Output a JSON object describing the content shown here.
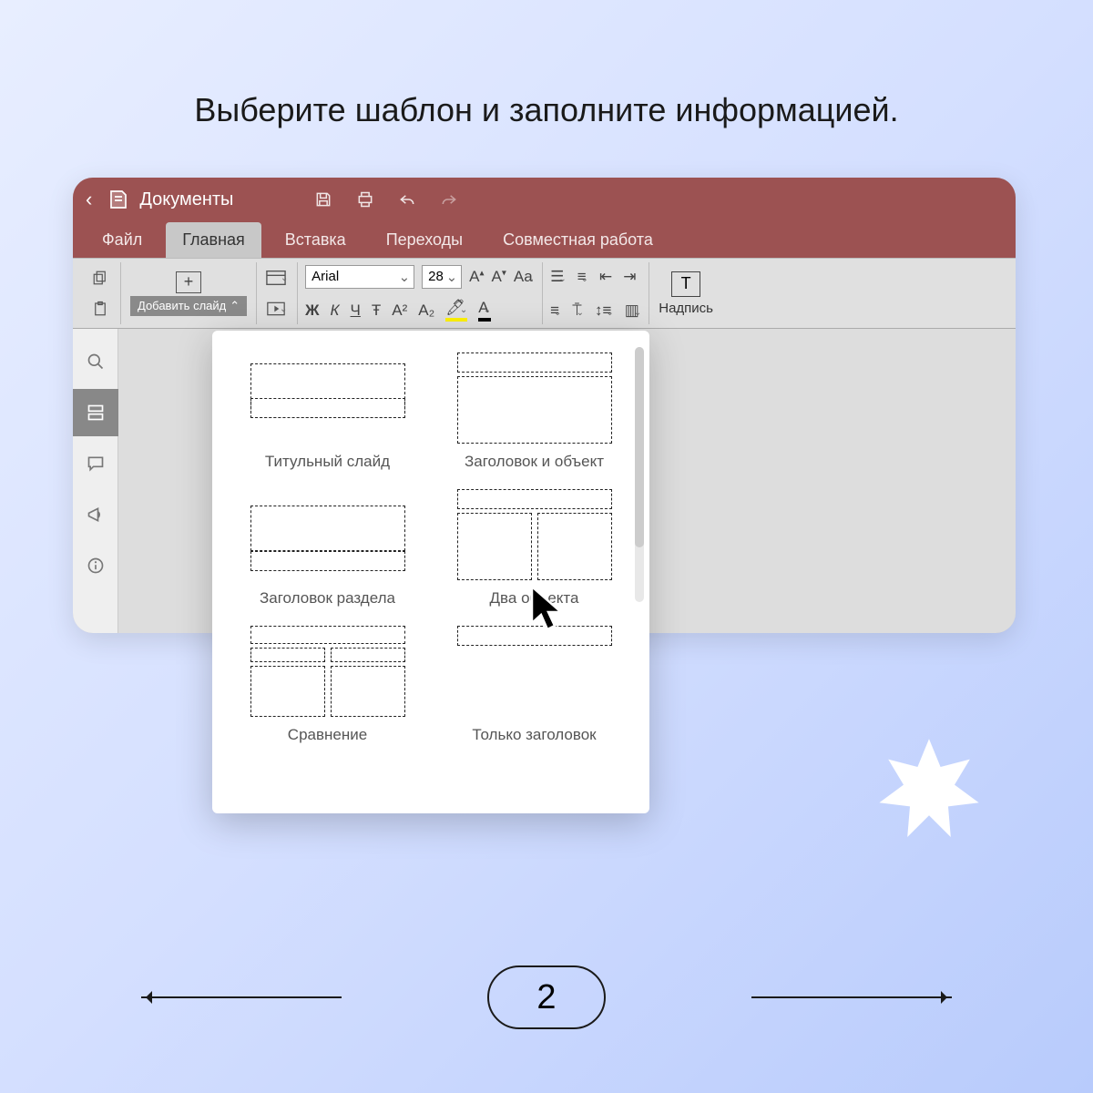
{
  "instruction": "Выберите шаблон и заполните информацией.",
  "header": {
    "app_name": "Документы"
  },
  "tabs": {
    "file": "Файл",
    "home": "Главная",
    "insert": "Вставка",
    "transitions": "Переходы",
    "collab": "Совместная работа"
  },
  "ribbon": {
    "add_slide": "Добавить слайд",
    "font_name": "Arial",
    "font_size": "28",
    "bold": "Ж",
    "italic": "К",
    "underline": "Ч",
    "strike": "Ŧ",
    "superscript": "A²",
    "subscript": "A₂",
    "textbox": "Надпись"
  },
  "layouts": {
    "title_slide": "Титульный слайд",
    "title_object": "Заголовок и объект",
    "section_header": "Заголовок раздела",
    "two_objects": "Два объекта",
    "comparison": "Сравнение",
    "title_only": "Только заголовок"
  },
  "pager": {
    "number": "2"
  }
}
